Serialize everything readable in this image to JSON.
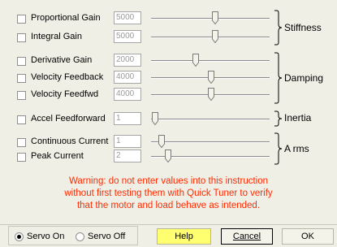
{
  "params": [
    {
      "label": "Proportional Gain",
      "value": "5000",
      "slider": 0.53
    },
    {
      "label": "Integral Gain",
      "value": "5000",
      "slider": 0.53
    },
    {
      "label": "Derivative Gain",
      "value": "2000",
      "slider": 0.35
    },
    {
      "label": "Velocity Feedback",
      "value": "4000",
      "slider": 0.48
    },
    {
      "label": "Velocity Feedfwd",
      "value": "4000",
      "slider": 0.48
    },
    {
      "label": "Accel Feedforward",
      "value": "1",
      "slider": 0.0
    },
    {
      "label": "Continuous Current",
      "value": "1",
      "slider": 0.03
    },
    {
      "label": "Peak Current",
      "value": "2",
      "slider": 0.11
    }
  ],
  "groups": {
    "stiffness": "Stiffness",
    "damping": "Damping",
    "inertia": "Inertia",
    "arms": "A rms"
  },
  "warning": {
    "line1": "Warning: do not enter values into this instruction",
    "line2": "without first testing them with Quick Tuner to verify",
    "line3": "that the motor and load behave as intended."
  },
  "servo": {
    "on_label": "Servo On",
    "off_label": "Servo Off",
    "selected": "on"
  },
  "buttons": {
    "help": "Help",
    "cancel": "Cancel",
    "ok": "OK"
  },
  "colors": {
    "warning": "#ff2a00",
    "help_bg": "#ffff70"
  }
}
